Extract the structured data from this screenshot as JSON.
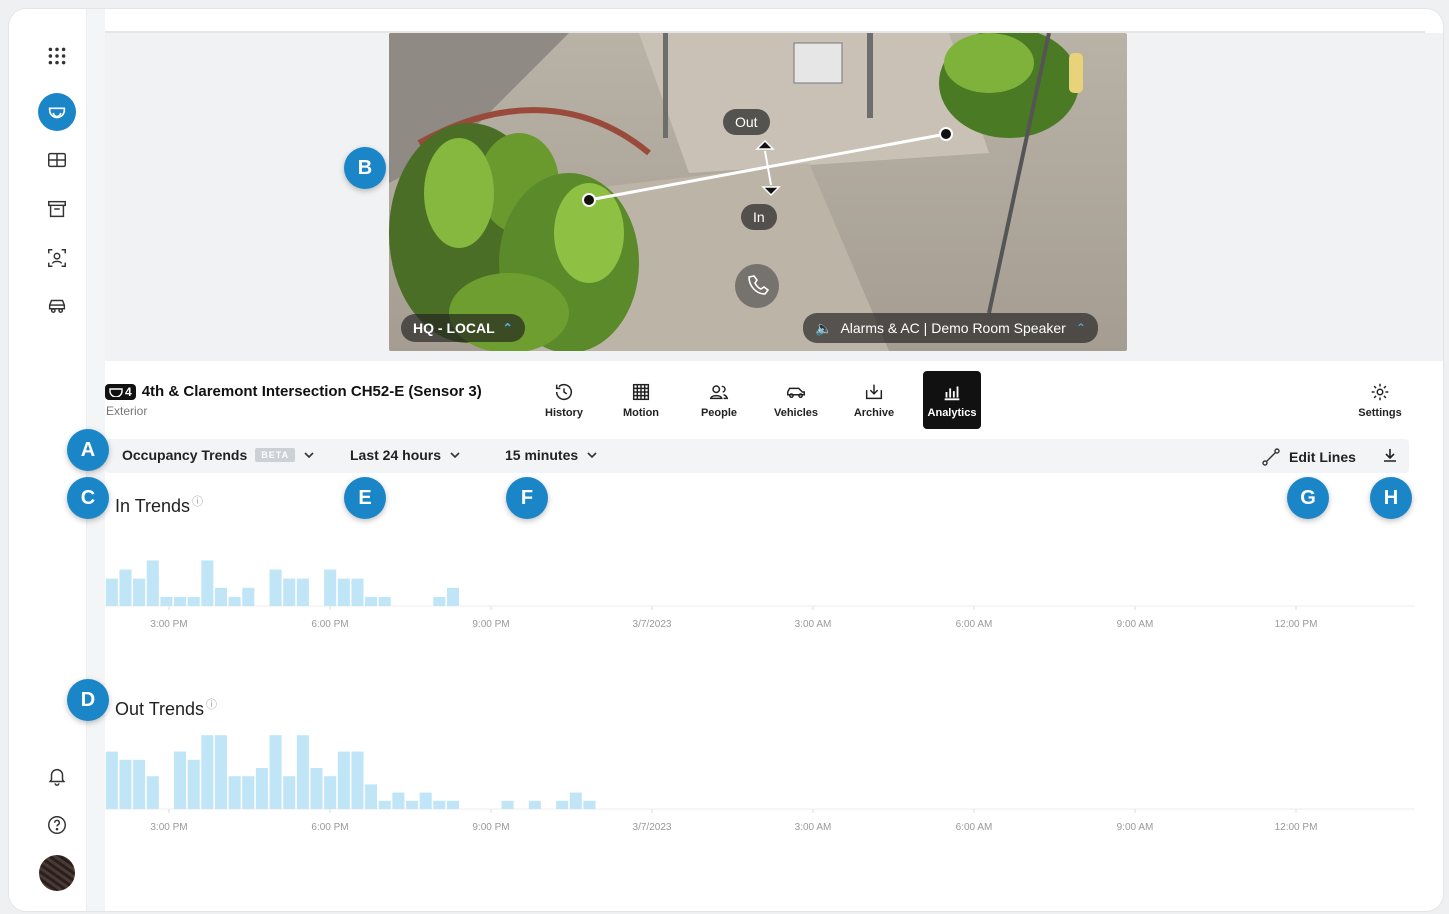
{
  "camera": {
    "title": "4th & Claremont Intersection CH52-E (Sensor 3)",
    "subtitle": "Exterior",
    "badge_count": "4"
  },
  "video": {
    "site_label": "HQ - LOCAL",
    "speaker_label": "Alarms & AC | Demo Room Speaker",
    "line_out_label": "Out",
    "line_in_label": "In"
  },
  "toolbar": [
    {
      "label": "History",
      "icon": "history-icon"
    },
    {
      "label": "Motion",
      "icon": "motion-grid-icon"
    },
    {
      "label": "People",
      "icon": "people-icon"
    },
    {
      "label": "Vehicles",
      "icon": "vehicle-icon"
    },
    {
      "label": "Archive",
      "icon": "archive-icon"
    },
    {
      "label": "Analytics",
      "icon": "analytics-icon",
      "selected": true
    }
  ],
  "settings_label": "Settings",
  "filters": {
    "report": "Occupancy Trends",
    "beta": "BETA",
    "range": "Last 24 hours",
    "interval": "15 minutes",
    "edit_lines": "Edit Lines"
  },
  "callouts": [
    "A",
    "B",
    "C",
    "D",
    "E",
    "F",
    "G",
    "H"
  ],
  "colors": {
    "accent": "#1a86c8",
    "bar": "#bfe5f7",
    "selected_tool": "#111111"
  },
  "chart_data": [
    {
      "type": "bar",
      "title": "In Trends",
      "x_ticks": [
        "3:00 PM",
        "6:00 PM",
        "9:00 PM",
        "3/7/2023",
        "3:00 AM",
        "6:00 AM",
        "9:00 AM",
        "12:00 PM"
      ],
      "values": [
        3,
        4,
        3,
        5,
        1,
        1,
        1,
        5,
        2,
        1,
        2,
        0,
        4,
        3,
        3,
        0,
        4,
        3,
        3,
        1,
        1,
        0,
        0,
        0,
        1,
        2,
        0,
        0,
        0,
        0,
        0,
        0,
        0,
        0,
        0,
        0,
        0,
        0,
        0,
        0,
        0,
        0,
        0,
        0,
        0,
        0,
        0,
        0,
        0,
        0,
        0,
        0,
        0,
        0,
        0,
        0,
        0,
        0,
        0,
        0,
        0,
        0,
        0,
        0,
        0,
        0,
        0,
        0,
        0,
        0,
        0,
        0,
        0,
        0,
        0,
        0,
        0,
        0,
        0,
        0,
        0,
        0,
        0,
        0,
        0,
        0,
        0,
        0,
        0,
        0,
        0,
        0,
        0,
        0,
        0,
        0,
        0,
        0,
        0,
        0,
        0,
        0,
        0,
        0,
        0,
        0,
        0,
        0,
        0,
        0,
        0,
        0,
        0,
        0,
        0,
        0,
        0,
        0,
        0,
        0,
        0,
        0,
        0,
        0,
        0,
        0,
        0,
        0,
        0,
        0,
        0,
        0,
        0,
        0,
        0,
        0,
        0,
        0,
        0,
        0,
        0,
        0,
        0,
        0,
        0,
        0,
        0,
        0,
        0,
        0,
        0,
        0,
        0,
        0,
        0,
        0,
        0,
        0,
        0,
        0,
        0,
        0,
        0,
        0,
        0,
        0,
        0,
        0,
        0,
        0,
        0,
        0,
        0,
        0,
        0,
        0,
        0,
        0,
        0,
        0,
        0,
        0,
        0,
        0,
        0,
        0,
        0,
        0,
        0,
        0,
        0,
        0,
        0,
        0,
        0,
        0,
        0,
        0,
        0,
        0,
        0,
        0,
        0,
        0,
        0,
        0,
        0,
        0,
        0,
        0,
        0
      ],
      "ylim": [
        0,
        9
      ]
    },
    {
      "type": "bar",
      "title": "Out Trends",
      "x_ticks": [
        "3:00 PM",
        "6:00 PM",
        "9:00 PM",
        "3/7/2023",
        "3:00 AM",
        "6:00 AM",
        "9:00 AM",
        "12:00 PM"
      ],
      "values": [
        7,
        6,
        6,
        4,
        0,
        7,
        6,
        9,
        9,
        4,
        4,
        5,
        9,
        4,
        9,
        5,
        4,
        7,
        7,
        3,
        1,
        2,
        1,
        2,
        1,
        1,
        0,
        0,
        0,
        1,
        0,
        1,
        0,
        1,
        2,
        1,
        0,
        0,
        0,
        0,
        0,
        0,
        0,
        0,
        0,
        0,
        0,
        0,
        0,
        0,
        0,
        0,
        0,
        0,
        0,
        0,
        0,
        0,
        0,
        0,
        0,
        0,
        0,
        0,
        0,
        0,
        0,
        0,
        0,
        0,
        0,
        0,
        0,
        0,
        0,
        0,
        0,
        0,
        0,
        0,
        0,
        0,
        0,
        0,
        0,
        0,
        0,
        0,
        0,
        0,
        0,
        0,
        0,
        0,
        0,
        0
      ],
      "ylim": [
        0,
        10
      ]
    }
  ]
}
